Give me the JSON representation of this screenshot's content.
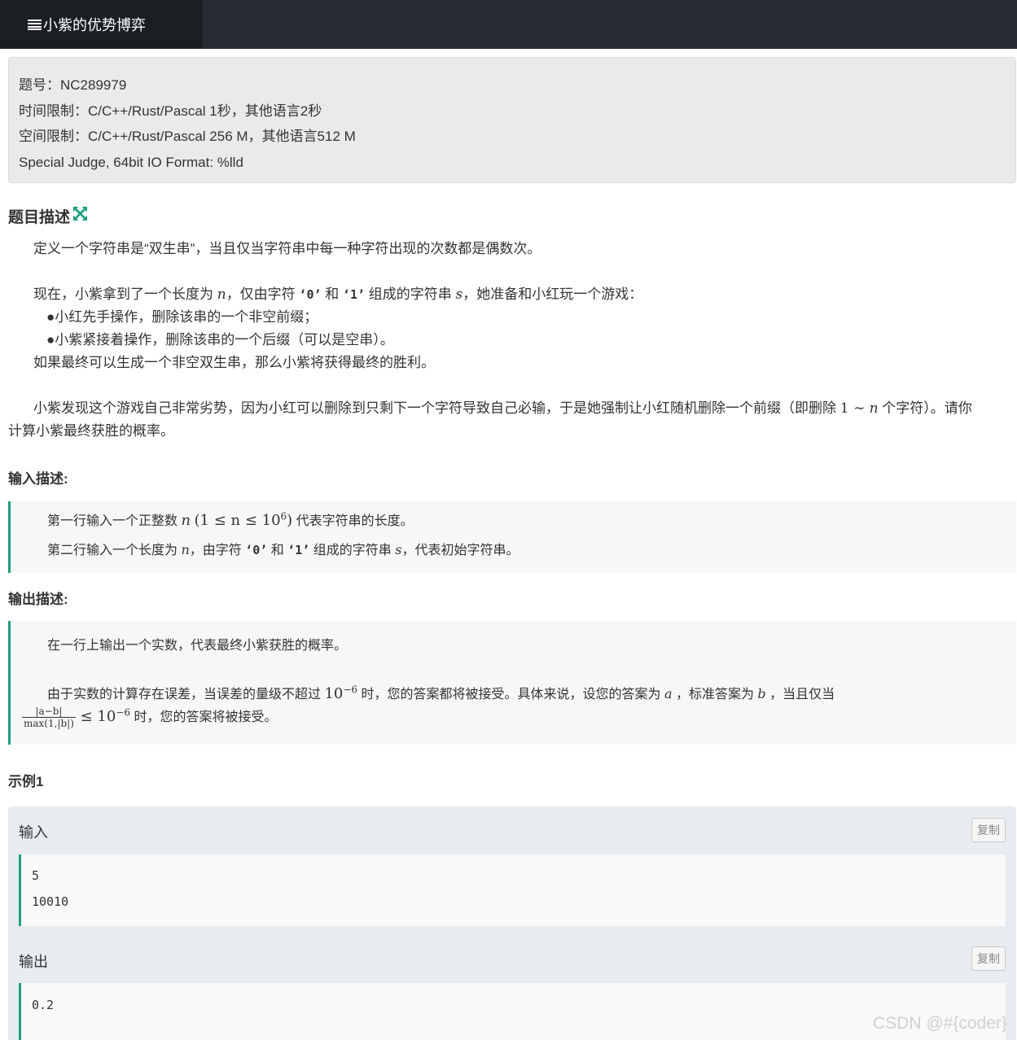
{
  "header": {
    "tab_title": "小紫的优势博弈"
  },
  "info": {
    "problem_id": "题号：NC289979",
    "time_limit": "时间限制：C/C++/Rust/Pascal 1秒，其他语言2秒",
    "memory_limit": "空间限制：C/C++/Rust/Pascal 256 M，其他语言512 M",
    "judge": "Special Judge, 64bit IO Format: %lld"
  },
  "description": {
    "heading": "题目描述",
    "p1": "定义一个字符串是“双生串”，当且仅当字符串中每一种字符出现的次数都是偶数次。",
    "p2_a": "现在，小紫拿到了一个长度为 ",
    "p2_n": "n",
    "p2_b": "，仅由字符 ",
    "p2_c0": "‘0’",
    "p2_c": " 和 ",
    "p2_c1": "‘1’",
    "p2_d": " 组成的字符串 ",
    "p2_s": "s",
    "p2_e": "，她准备和小红玩一个游戏：",
    "bullet1": "●小红先手操作，删除该串的一个非空前缀；",
    "bullet2": "●小紫紧接着操作，删除该串的一个后缀（可以是空串）。",
    "p3": "如果最终可以生成一个非空双生串，那么小紫将获得最终的胜利。",
    "p4_a": "小紫发现这个游戏自己非常劣势，因为小红可以删除到只剩下一个字符导致自己必输，于是她强制让小红随机删除一个前缀（即删除 ",
    "p4_range": "1 ∼ ",
    "p4_n": "n",
    "p4_b": " 个字符）。请你",
    "p4_c": "计算小紫最终获胜的概率。"
  },
  "input": {
    "heading": "输入描述:",
    "l1_a": "第一行输入一个正整数 ",
    "l1_math": "n",
    "l1_cond": "(1 ≤ n ≤ 10",
    "l1_exp": "6",
    "l1_close": ")",
    "l1_b": " 代表字符串的长度。",
    "l2_a": "第二行输入一个长度为 ",
    "l2_n": "n",
    "l2_b": "，由字符 ",
    "l2_c0": "‘0’",
    "l2_c": " 和 ",
    "l2_c1": "‘1’",
    "l2_d": " 组成的字符串 ",
    "l2_s": "s",
    "l2_e": "，代表初始字符串。"
  },
  "output": {
    "heading": "输出描述:",
    "l1": "在一行上输出一个实数，代表最终小紫获胜的概率。",
    "l2_a": "由于实数的计算存在误差，当误差的量级不超过 ",
    "l2_base": "10",
    "l2_exp": "−6",
    "l2_b": " 时，您的答案都将被接受。具体来说，设您的答案为 ",
    "l2_ans": "a",
    "l2_c": " ，标准答案为 ",
    "l2_std": "b",
    "l2_d": " ，当且仅当",
    "frac_num": "|a−b|",
    "frac_den": "max(1,|b|)",
    "l3_le": " ≤ 10",
    "l3_exp": "−6",
    "l3_b": " 时，您的答案将被接受。"
  },
  "sample": {
    "heading": "示例1",
    "input_label": "输入",
    "output_label": "输出",
    "copy_label": "复制",
    "input_lines": [
      "5",
      "10010"
    ],
    "output_lines": [
      "0.2"
    ]
  },
  "watermark": "CSDN @#{coder}"
}
